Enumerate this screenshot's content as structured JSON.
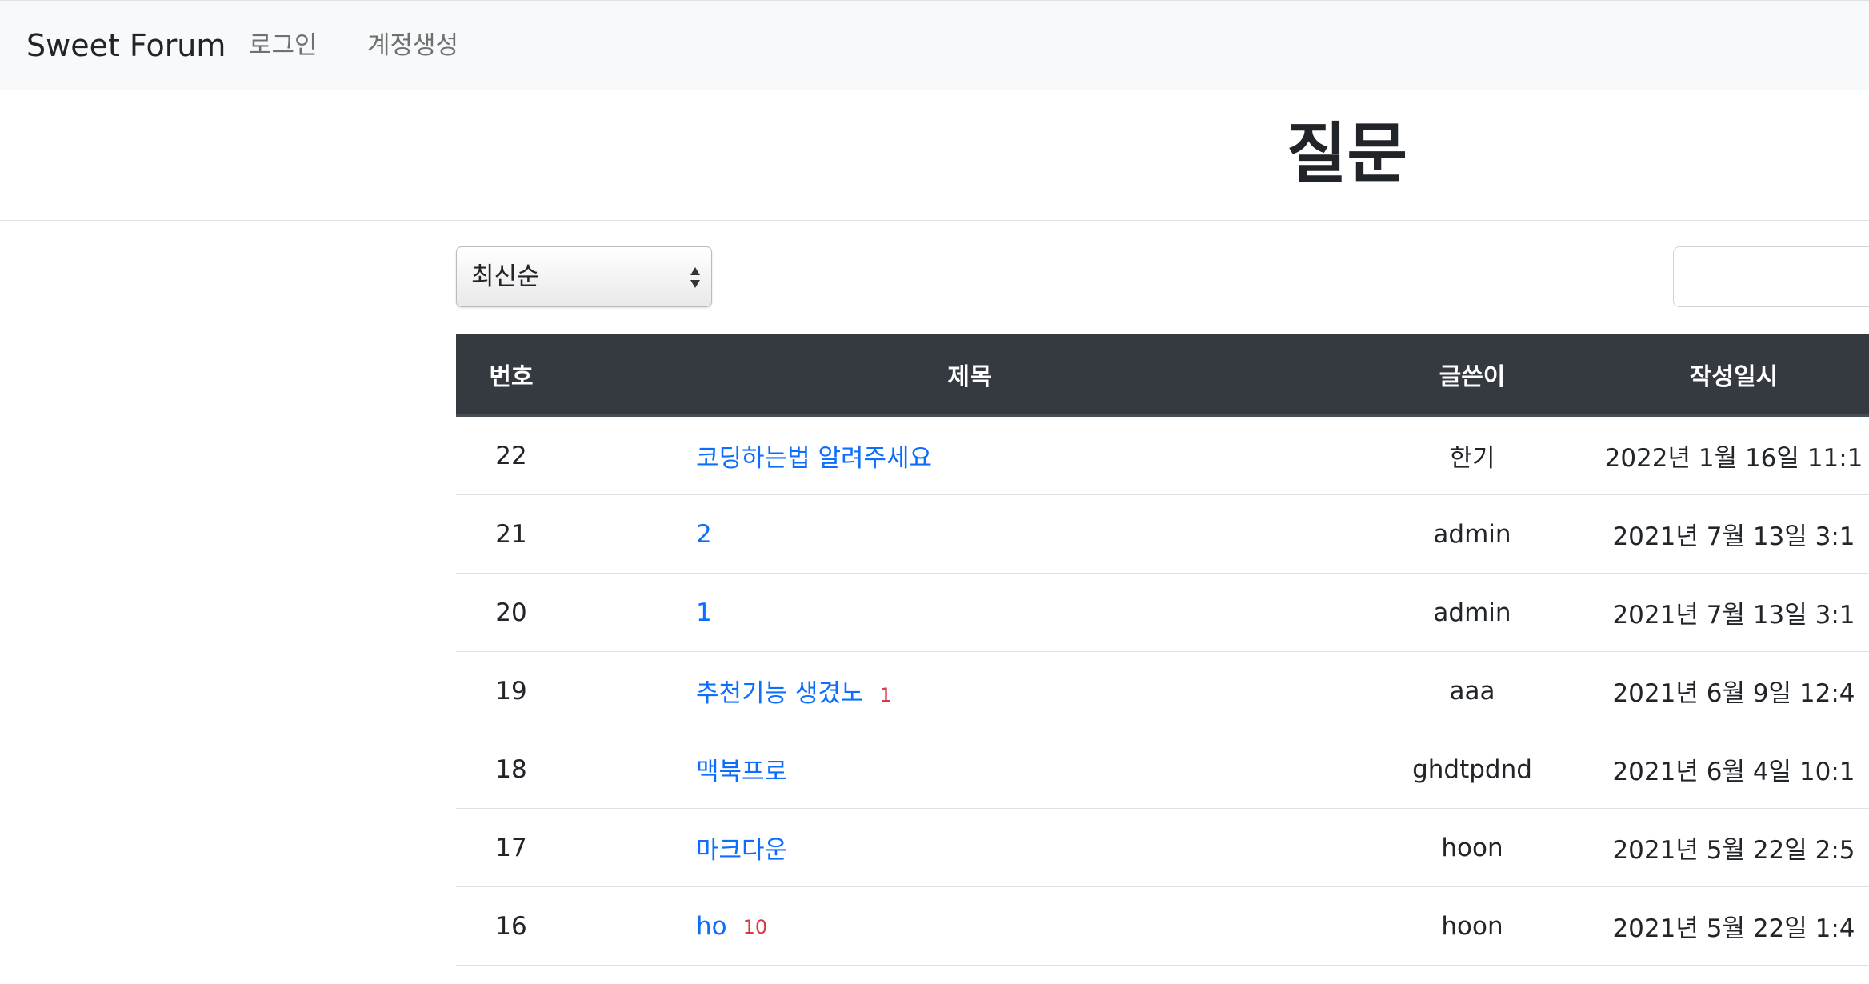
{
  "navbar": {
    "brand": "Sweet Forum",
    "links": [
      {
        "label": "로그인"
      },
      {
        "label": "계정생성"
      }
    ]
  },
  "page": {
    "title": "질문"
  },
  "sort": {
    "selected": "최신순"
  },
  "search": {
    "value": "",
    "placeholder": ""
  },
  "table": {
    "headers": {
      "number": "번호",
      "title": "제목",
      "author": "글쓴이",
      "date": "작성일시"
    },
    "rows": [
      {
        "number": "22",
        "title": "코딩하는법 알려주세요",
        "comments": "",
        "author": "한기",
        "date": "2022년 1월 16일 11:1"
      },
      {
        "number": "21",
        "title": "2",
        "comments": "",
        "author": "admin",
        "date": "2021년 7월 13일 3:1"
      },
      {
        "number": "20",
        "title": "1",
        "comments": "",
        "author": "admin",
        "date": "2021년 7월 13일 3:1"
      },
      {
        "number": "19",
        "title": "추천기능 생겼노",
        "comments": "1",
        "author": "aaa",
        "date": "2021년 6월 9일 12:4"
      },
      {
        "number": "18",
        "title": "맥북프로",
        "comments": "",
        "author": "ghdtpdnd",
        "date": "2021년 6월 4일 10:1"
      },
      {
        "number": "17",
        "title": "마크다운",
        "comments": "",
        "author": "hoon",
        "date": "2021년 5월 22일 2:5"
      },
      {
        "number": "16",
        "title": "ho",
        "comments": "10",
        "author": "hoon",
        "date": "2021년 5월 22일 1:4"
      }
    ]
  },
  "colors": {
    "link": "#0d6efd",
    "comment_badge": "#dc3545",
    "table_header_bg": "#343a40",
    "navbar_bg": "#f8f9fa"
  }
}
